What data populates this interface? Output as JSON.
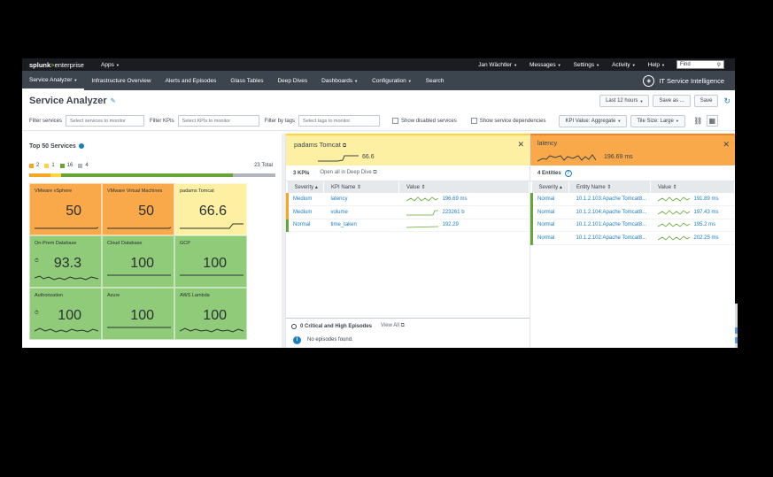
{
  "topbar": {
    "logo_splunk": "splunk",
    "logo_gt": ">",
    "logo_enterprise": "enterprise",
    "apps": "Apps",
    "user": "Jan Wächtler",
    "messages": "Messages",
    "settings": "Settings",
    "activity": "Activity",
    "help": "Help",
    "find_placeholder": "Find"
  },
  "appbar": {
    "items": [
      "Service Analyzer",
      "Infrastructure Overview",
      "Alerts and Episodes",
      "Glass Tables",
      "Deep Dives",
      "Dashboards",
      "Configuration",
      "Search"
    ],
    "app_title": "IT Service Intelligence"
  },
  "titlebar": {
    "title": "Service Analyzer",
    "time_range": "Last 12 hours",
    "save_as": "Save as ...",
    "save": "Save"
  },
  "filters": {
    "services_label": "Filter services",
    "services_placeholder": "Select services to monitor",
    "kpis_label": "Filter KPIs",
    "kpis_placeholder": "Select KPIs to monitor",
    "tags_label": "Filter by tags",
    "tags_placeholder": "Select tags to monitor",
    "show_disabled": "Show disabled services",
    "show_dependencies": "Show service dependencies",
    "kpi_value": "KPI Value: Aggregate",
    "tile_size": "Tile Size: Large"
  },
  "top_services": {
    "title": "Top 50 Services",
    "legend": [
      {
        "count": "2",
        "color": "#f5a623"
      },
      {
        "count": "1",
        "color": "#ffd53e"
      },
      {
        "count": "16",
        "color": "#65a637"
      },
      {
        "count": "4",
        "color": "#b0b6bc"
      }
    ],
    "total": "23 Total",
    "tiles": [
      {
        "name": "VMware vSphere",
        "value": "50",
        "color": "#f9a94a",
        "alarm": false
      },
      {
        "name": "VMware Virtual Machines",
        "value": "50",
        "color": "#f9a94a",
        "alarm": false
      },
      {
        "name": "padams Tomcat",
        "value": "66.6",
        "color": "#fdf0a2",
        "alarm": false
      },
      {
        "name": "On-Prem Database",
        "value": "93.3",
        "color": "#8fcb78",
        "alarm": true
      },
      {
        "name": "Cloud Database",
        "value": "100",
        "color": "#8fcb78",
        "alarm": false
      },
      {
        "name": "GCP",
        "value": "100",
        "color": "#8fcb78",
        "alarm": false
      },
      {
        "name": "Authorization",
        "value": "100",
        "color": "#8fcb78",
        "alarm": true
      },
      {
        "name": "Azure",
        "value": "100",
        "color": "#8fcb78",
        "alarm": false
      },
      {
        "name": "AWS Lambda",
        "value": "100",
        "color": "#8fcb78",
        "alarm": false
      }
    ]
  },
  "service_panel": {
    "title": "padams Tomcat",
    "value": "66.6",
    "kpi_count": "3 KPIs",
    "open_all": "Open all in Deep Dive",
    "columns": [
      "Severity",
      "KPI Name",
      "Value"
    ],
    "rows": [
      {
        "severity": "Medium",
        "name": "latency",
        "value": "196.69 ms"
      },
      {
        "severity": "Medium",
        "name": "volume",
        "value": "223261 b"
      },
      {
        "severity": "Normal",
        "name": "time_taken",
        "value": "192.29"
      }
    ],
    "episodes_title": "0 Critical and High Episodes",
    "view_all": "View All",
    "no_episodes": "No episodes found."
  },
  "kpi_panel": {
    "title": "latency",
    "value": "196.69 ms",
    "entity_count": "4 Entities",
    "columns": [
      "Severity",
      "Entity Name",
      "Value"
    ],
    "rows": [
      {
        "severity": "Normal",
        "name": "10.1.2.103:Apache Tomcat8...",
        "value": "191.89 ms"
      },
      {
        "severity": "Normal",
        "name": "10.1.2.104:Apache Tomcat8...",
        "value": "197.43 ms"
      },
      {
        "severity": "Normal",
        "name": "10.1.2.101:Apache Tomcat8...",
        "value": "195.2 ms"
      },
      {
        "severity": "Normal",
        "name": "10.1.2.102:Apache Tomcat8...",
        "value": "202.25 ms"
      }
    ]
  }
}
